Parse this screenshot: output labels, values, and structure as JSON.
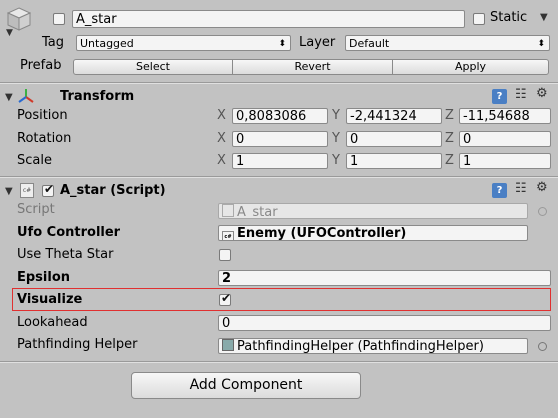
{
  "header": {
    "name_value": "A_star",
    "static_label": "Static",
    "tag_label": "Tag",
    "tag_value": "Untagged",
    "layer_label": "Layer",
    "layer_value": "Default",
    "prefab_label": "Prefab",
    "select_label": "Select",
    "revert_label": "Revert",
    "apply_label": "Apply"
  },
  "transform": {
    "title": "Transform",
    "position_label": "Position",
    "rotation_label": "Rotation",
    "scale_label": "Scale",
    "axis_x": "X",
    "axis_y": "Y",
    "axis_z": "Z",
    "position": [
      "0,8083086",
      "-2,441324",
      "-11,54688"
    ],
    "rotation": [
      "0",
      "0",
      "0"
    ],
    "scale": [
      "1",
      "1",
      "1"
    ]
  },
  "script_component": {
    "title": "A_star (Script)",
    "script_label": "Script",
    "script_value": "A_star",
    "ufo_label": "Ufo Controller",
    "ufo_value": "Enemy (UFOController)",
    "theta_label": "Use Theta Star",
    "theta_checked": false,
    "epsilon_label": "Epsilon",
    "epsilon_value": "2",
    "visualize_label": "Visualize",
    "visualize_checked": true,
    "lookahead_label": "Lookahead",
    "lookahead_value": "0",
    "helper_label": "Pathfinding Helper",
    "helper_value": "PathfindingHelper (PathfindingHelper)"
  },
  "footer": {
    "add_component_label": "Add Component"
  },
  "colors": {
    "background": "#c2c2c2",
    "highlight_border": "#e03030",
    "checkbox_accent": "#2a6bd1"
  }
}
